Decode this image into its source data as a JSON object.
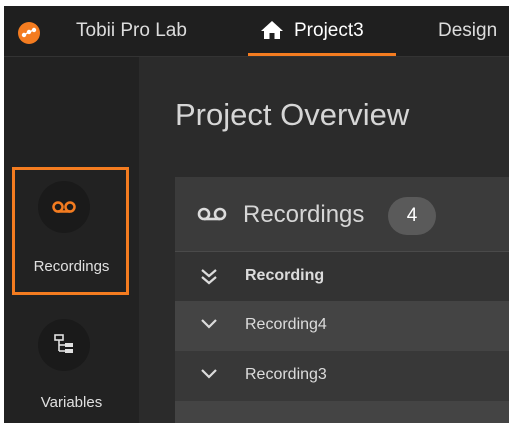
{
  "app": {
    "logo_icon": "tobii-logo-icon",
    "name": "Tobii Pro Lab",
    "accent_color": "#f47c20"
  },
  "tabs": [
    {
      "label": "Project3",
      "icon": "home-icon",
      "active": true
    },
    {
      "label": "Design",
      "active": false
    }
  ],
  "sidebar": {
    "items": [
      {
        "label": "Recordings",
        "icon": "recordings-icon",
        "active": true
      },
      {
        "label": "Variables",
        "icon": "variables-icon",
        "active": false
      }
    ]
  },
  "main": {
    "title": "Project Overview",
    "panel": {
      "title": "Recordings",
      "icon": "recordings-icon",
      "count": "4",
      "header_label": "Recording",
      "rows": [
        {
          "label": "Recording4"
        },
        {
          "label": "Recording3"
        }
      ]
    }
  }
}
